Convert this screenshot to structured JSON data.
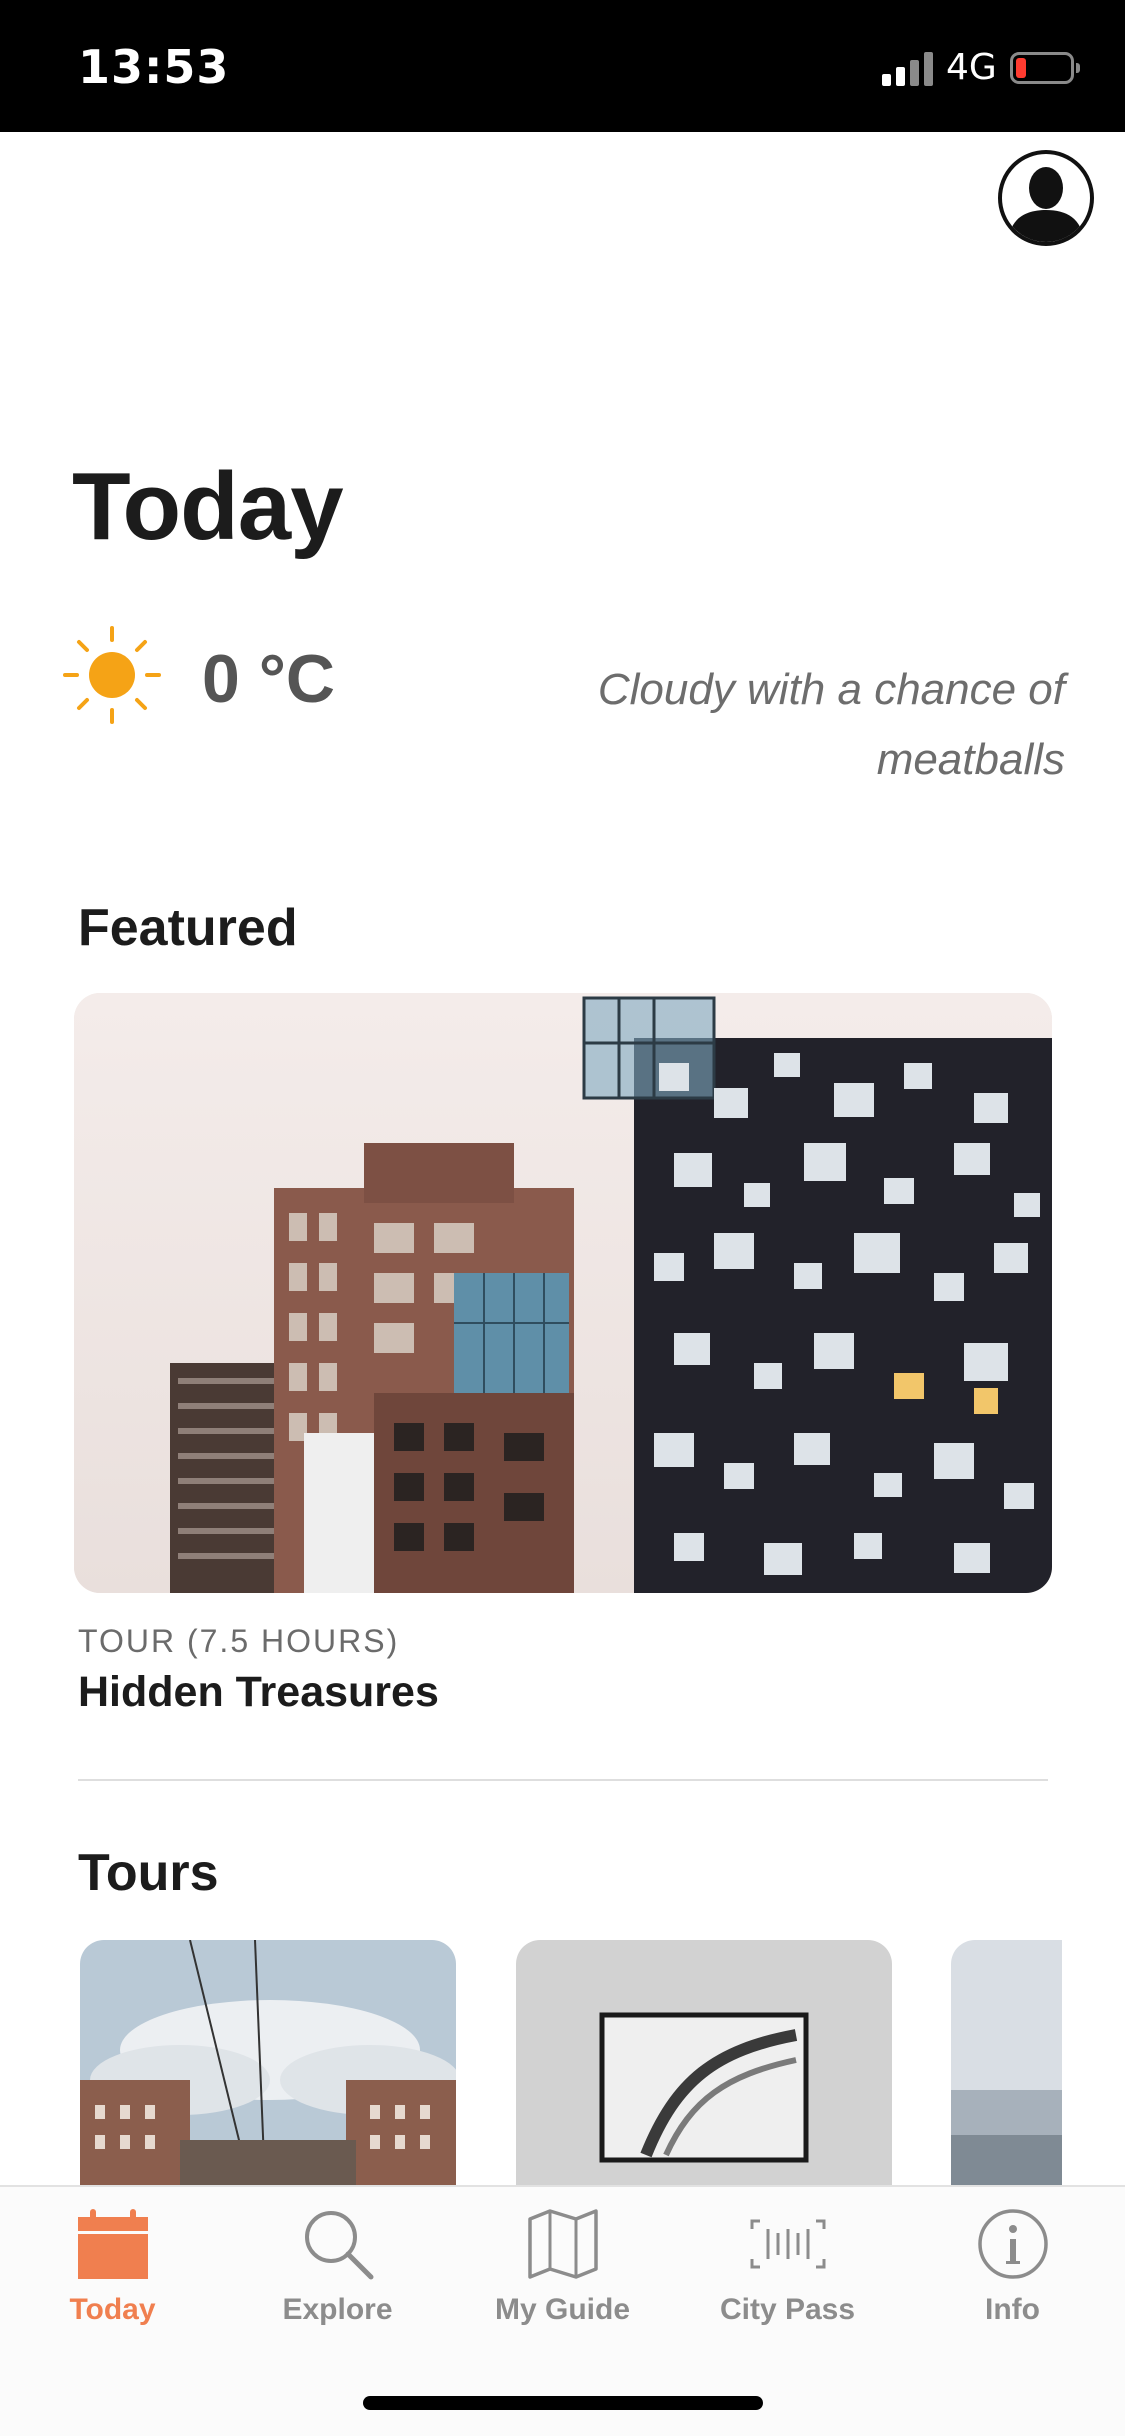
{
  "status_bar": {
    "time": "13:53",
    "network": "4G"
  },
  "header": {
    "title": "Today"
  },
  "weather": {
    "icon": "sun-icon",
    "temperature": "0 °C",
    "description": "Cloudy with a chance of meatballs"
  },
  "featured": {
    "heading": "Featured",
    "card": {
      "meta": "TOUR (7.5 HOURS)",
      "title": "Hidden Treasures"
    }
  },
  "tours": {
    "heading": "Tours"
  },
  "tab_bar": {
    "tabs": [
      {
        "label": "Today",
        "icon": "calendar-icon",
        "active": true
      },
      {
        "label": "Explore",
        "icon": "magnifier-icon",
        "active": false
      },
      {
        "label": "My Guide",
        "icon": "map-icon",
        "active": false
      },
      {
        "label": "City Pass",
        "icon": "barcode-icon",
        "active": false
      },
      {
        "label": "Info",
        "icon": "info-icon",
        "active": false
      }
    ]
  },
  "colors": {
    "accent": "#f07f4f",
    "sun": "#f5a316",
    "inactive_tab": "#8c8c8c"
  }
}
